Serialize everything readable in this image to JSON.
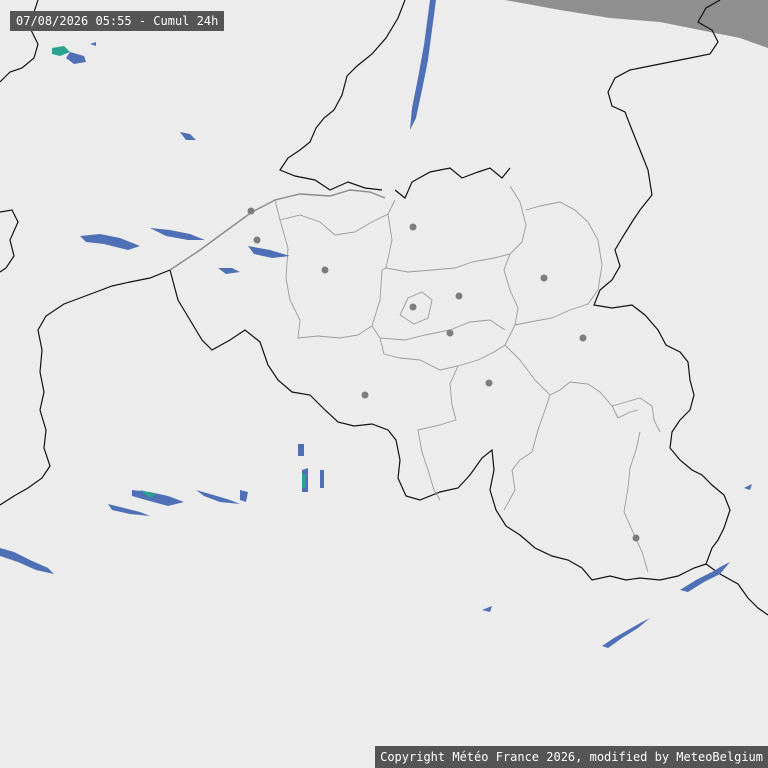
{
  "timestamp_label": "07/08/2026 05:55 - Cumul 24h",
  "copyright": "Copyright Météo France 2026, modified by MeteoBelgium",
  "colors": {
    "background": "#ececec",
    "sea": "#8f8f8f",
    "border_line": "#111111",
    "province_line": "#9a9a9a",
    "city_dot": "#7d7d7d",
    "precip_light": "#4f6fb6",
    "precip_moderate": "#2aa28f",
    "label_bg": "#555555",
    "label_text": "#ffffff"
  }
}
